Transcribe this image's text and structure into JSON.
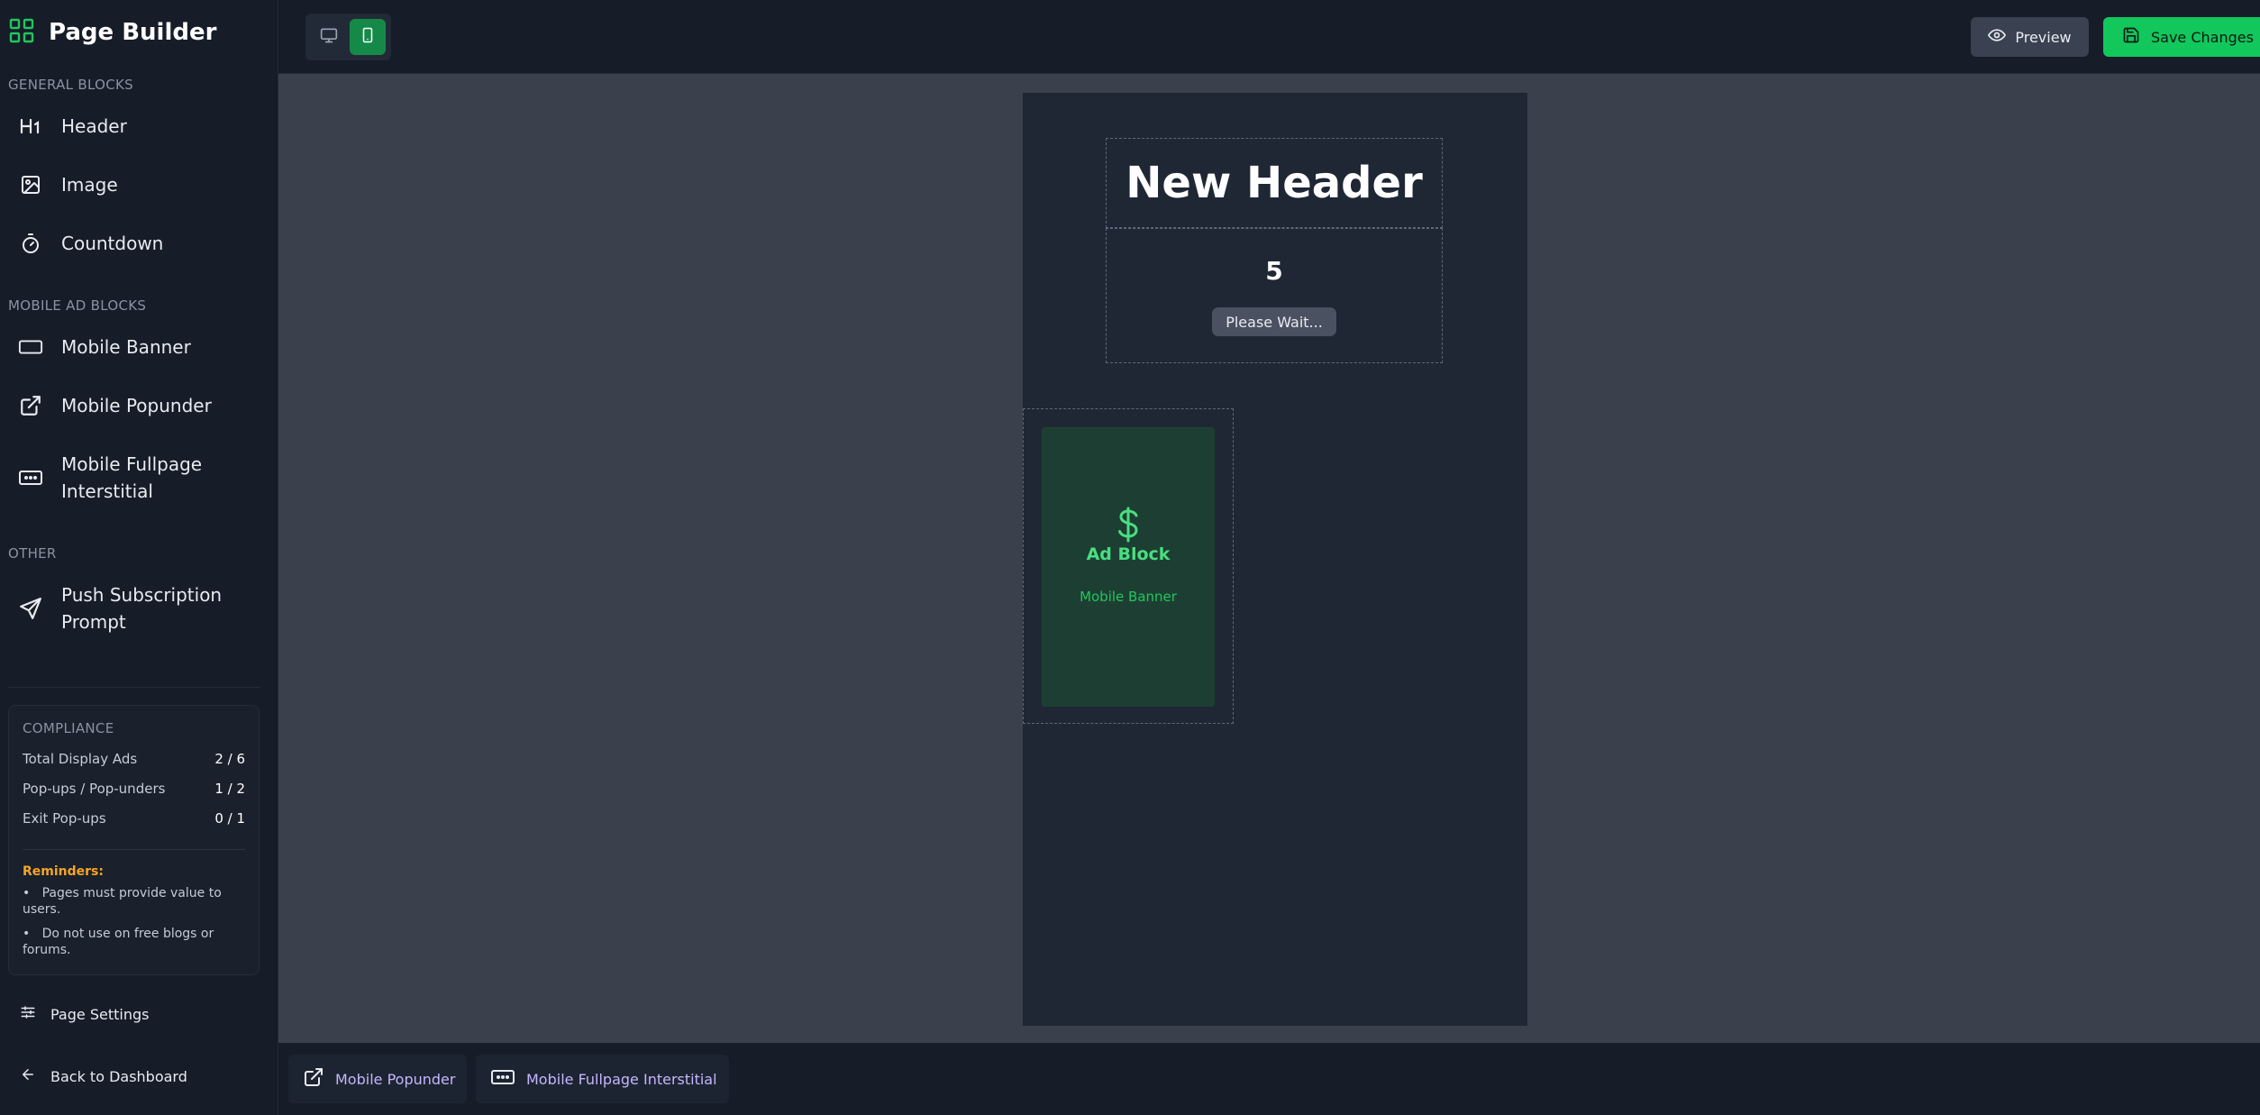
{
  "brand": {
    "title": "Page Builder",
    "icon": "grid-icon",
    "accent": "#22c55e"
  },
  "sidebar": {
    "general_label": "GENERAL BLOCKS",
    "general": [
      {
        "label": "Header",
        "icon": "heading-icon"
      },
      {
        "label": "Image",
        "icon": "image-icon"
      },
      {
        "label": "Countdown",
        "icon": "timer-icon"
      }
    ],
    "mobile_label": "MOBILE AD BLOCKS",
    "mobile": [
      {
        "label": "Mobile Banner",
        "icon": "banner-icon"
      },
      {
        "label": "Mobile Popunder",
        "icon": "external-link-icon"
      },
      {
        "label": "Mobile Fullpage Interstitial",
        "line1": "Mobile Fullpage",
        "line2": "Interstitial",
        "icon": "interstitial-icon"
      }
    ],
    "other_label": "OTHER",
    "other": [
      {
        "label": "Push Subscription Prompt",
        "line1": "Push Subscription",
        "line2": "Prompt",
        "icon": "send-icon"
      }
    ]
  },
  "compliance": {
    "label": "COMPLIANCE",
    "rows": [
      {
        "label": "Total Display Ads",
        "value": "2 / 6"
      },
      {
        "label": "Pop-ups / Pop-unders",
        "value": "1 / 2"
      },
      {
        "label": "Exit Pop-ups",
        "value": "0 / 1"
      }
    ],
    "reminders_title": "Reminders:",
    "reminders": [
      "Pages must provide value to users.",
      "Do not use on free blogs or forums."
    ]
  },
  "footer": {
    "settings": "Page Settings",
    "back": "Back to Dashboard"
  },
  "toolbar": {
    "device_active": "mobile",
    "preview": "Preview",
    "save": "Save Changes",
    "save_color": "#12c75c"
  },
  "canvas": {
    "header_text": "New Header",
    "countdown_value": "5",
    "wait_label": "Please Wait...",
    "ad_title": "Ad Block",
    "ad_subtitle": "Mobile Banner"
  },
  "tray": [
    {
      "label": "Mobile Popunder",
      "icon": "external-link-icon"
    },
    {
      "label": "Mobile Fullpage Interstitial",
      "icon": "interstitial-icon"
    }
  ]
}
